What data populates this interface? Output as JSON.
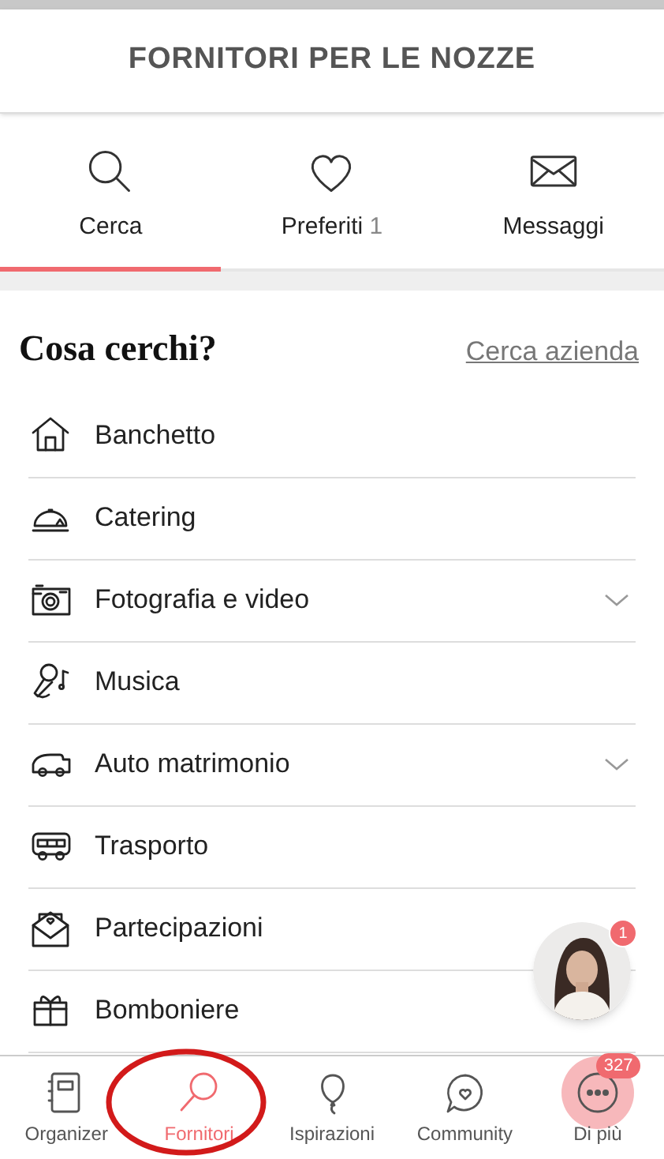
{
  "header": {
    "title": "FORNITORI PER LE NOZZE"
  },
  "tabs": [
    {
      "label": "Cerca",
      "selected": true
    },
    {
      "label": "Preferiti",
      "count": "1",
      "selected": false
    },
    {
      "label": "Messaggi",
      "selected": false
    }
  ],
  "search": {
    "heading": "Cosa cerchi?",
    "link": "Cerca azienda"
  },
  "categories": [
    {
      "label": "Banchetto",
      "expandable": false
    },
    {
      "label": "Catering",
      "expandable": false
    },
    {
      "label": "Fotografia e video",
      "expandable": true
    },
    {
      "label": "Musica",
      "expandable": false
    },
    {
      "label": "Auto matrimonio",
      "expandable": true
    },
    {
      "label": "Trasporto",
      "expandable": false
    },
    {
      "label": "Partecipazioni",
      "expandable": false
    },
    {
      "label": "Bomboniere",
      "expandable": false
    }
  ],
  "chat": {
    "kind": "picture",
    "badge": "1"
  },
  "nav": [
    {
      "label": "Organizer",
      "selected": false
    },
    {
      "label": "Fornitori",
      "selected": true,
      "circled": true
    },
    {
      "label": "Ispirazioni",
      "selected": false
    },
    {
      "label": "Community",
      "selected": false
    },
    {
      "label": "Di più",
      "selected": false,
      "badge": "327",
      "highlighted": true
    }
  ]
}
